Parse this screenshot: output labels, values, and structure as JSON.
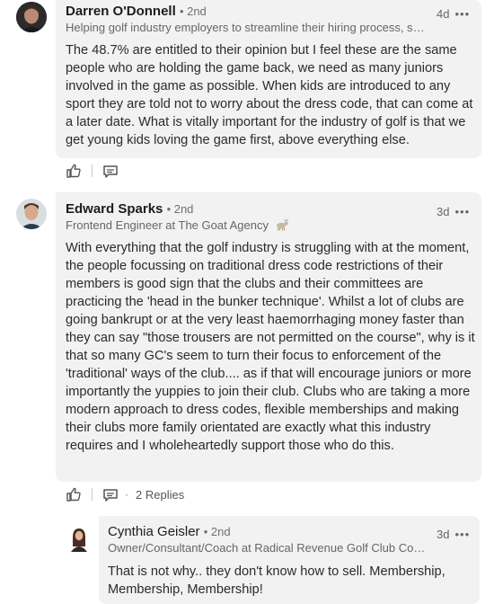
{
  "comments": [
    {
      "name": "Darren O'Donnell",
      "degree": "• 2nd",
      "headline": "Helping golf industry employers to streamline their hiring process, sa...",
      "time": "4d",
      "more": "•••",
      "body": "The 48.7% are entitled to their opinion but I feel these are the same people who are holding the game back, we need as many juniors involved in the game as possible.  When kids are introduced to any sport they are told not to worry about the dress code, that can come at a later date.  What is vitally important for the industry of golf is that we get young kids loving the game first, above everything else."
    },
    {
      "name": "Edward Sparks",
      "degree": "• 2nd",
      "headline": "Frontend Engineer at The Goat Agency",
      "headline_emoji": "goat-icon",
      "time": "3d",
      "more": "•••",
      "body": "With everything that the golf industry is struggling with at the moment, the people focussing on traditional dress code restrictions of their members is good sign that the clubs and their committees are practicing the 'head in the bunker technique'. Whilst a lot of clubs are going bankrupt or at the very least haemorrhaging money faster than they can say \"those trousers are not permitted on the course\", why is it that so many GC's seem to turn their focus to enforcement of the 'traditional' ways of the club.... as if that will encourage juniors or more importantly the yuppies to join their club. Clubs who are taking a more modern approach to dress codes, flexible memberships and making their clubs more family orientated are exactly what this industry requires and I wholeheartedly support those who do this.",
      "dot": "·",
      "replies": "2 Replies"
    },
    {
      "name": "Cynthia Geisler",
      "degree": "• 2nd",
      "headline": "Owner/Consultant/Coach at Radical Revenue Golf Club Cons...",
      "time": "3d",
      "more": "•••",
      "body": "That is not why.. they don't know how to sell. Membership, Membership, Membership!"
    }
  ],
  "colors": {
    "bubble": "#f2f2f2",
    "name": "#1d1d1d",
    "muted": "#666666"
  }
}
